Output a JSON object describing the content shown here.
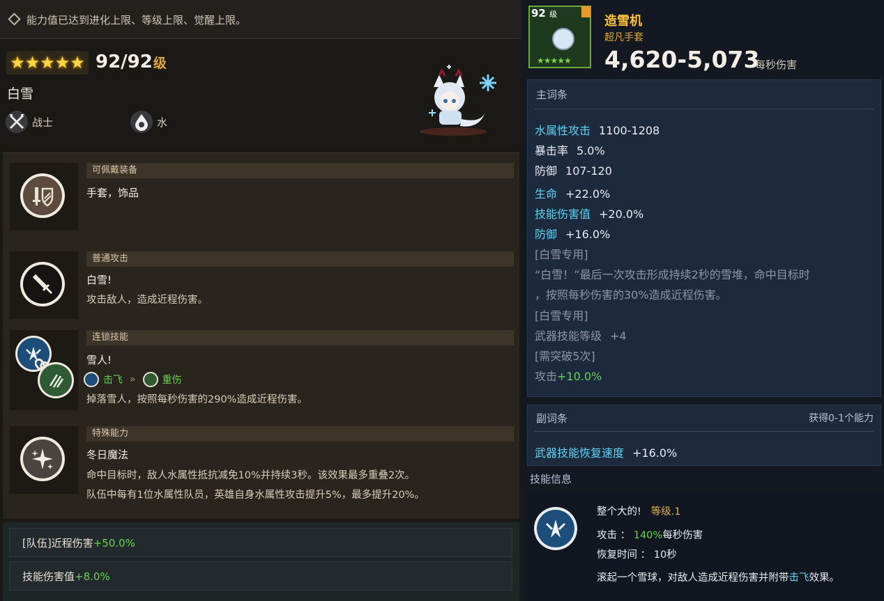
{
  "notice": {
    "text": "能力值已达到进化上限、等级上限、觉醒上限。"
  },
  "hero": {
    "stars": "★★★★★",
    "level": "92/92",
    "level_unit": "级",
    "name": "白雪",
    "class_label": "战士",
    "element_label": "水"
  },
  "sections": {
    "equip": {
      "header": "可佩戴装备",
      "text": "手套，饰品"
    },
    "normal": {
      "header": "普通攻击",
      "title": "白雪!",
      "desc": "攻击敌人，造成近程伤害。"
    },
    "chain": {
      "header": "连锁技能",
      "title": "雪人!",
      "tag1": "击飞",
      "arrow": "»",
      "tag2": "重伤",
      "desc": "掉落雪人，按照每秒伤害的290%造成近程伤害。"
    },
    "special": {
      "header": "特殊能力",
      "title": "冬日魔法",
      "desc1": "命中目标时，敌人水属性抵抗减免10%并持续3秒。该效果最多重叠2次。",
      "desc2": "队伍中每有1位水属性队员，英雄自身水属性攻击提升5%，最多提升20%。"
    }
  },
  "team_bonus": [
    {
      "label": "[队伍]近程伤害",
      "value": "+50.0%"
    },
    {
      "label": "技能伤害值",
      "value": "+8.0%"
    }
  ],
  "item": {
    "level": "92",
    "level_unit": "级",
    "stars": "★★★★★",
    "name": "造雪机",
    "type": "超凡手套",
    "damage": "4,620-5,073",
    "damage_label": "每秒伤害"
  },
  "main_options": {
    "header": "主词条",
    "stats": [
      {
        "k": "水属性攻击",
        "v": "1100-1208"
      },
      {
        "k": "暴击率",
        "v": "5.0%"
      },
      {
        "k": "防御",
        "v": "107-120"
      },
      {
        "k": "生命",
        "v": "+22.0%"
      },
      {
        "k": "技能伤害值",
        "v": "+20.0%"
      },
      {
        "k": "防御",
        "v": "+16.0%"
      }
    ],
    "exclusive1": "[白雪专用]",
    "exclusive_desc1": "“白雪！”最后一次攻击形成持续2秒的雪堆，命中目标时",
    "exclusive_desc2": "，按照每秒伤害的30%造成近程伤害。",
    "exclusive2": "[白雪专用]",
    "weapon_skill_k": "武器技能等级",
    "weapon_skill_v": "+4",
    "limit_break": "[需突破5次]",
    "attack_k": "攻击",
    "attack_v": "+10.0%"
  },
  "sub_options": {
    "header": "副词条",
    "right": "获得0-1个能力",
    "stat_k": "武器技能恢复速度",
    "stat_v": "+16.0%"
  },
  "skill_info": {
    "header": "技能信息",
    "name": "整个大的!",
    "level": "等级.1",
    "attack_k": "攻击 ：",
    "attack_pct": "140%",
    "attack_unit": "每秒伤害",
    "cd_k": "恢复时间 ：",
    "cd_v": "10秒",
    "desc_a": "滚起一个雪球，对敌人造成近程伤害并附带",
    "desc_b": "击飞",
    "desc_c": "效果。"
  },
  "colors": {
    "gold": "#ffc23a",
    "green": "#64d64a",
    "cyan": "#5fd2f0"
  }
}
